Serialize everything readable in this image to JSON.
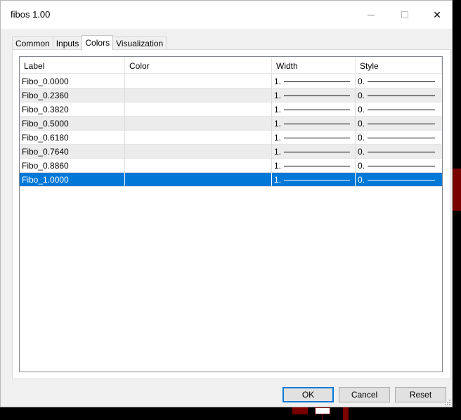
{
  "window": {
    "title": "fibos 1.00"
  },
  "titlebar_buttons": {
    "minimize": "minimize-icon",
    "maximize": "maximize-icon",
    "close": "close-icon",
    "close_glyph": "✕"
  },
  "tabs": [
    {
      "label": "Common",
      "active": false
    },
    {
      "label": "Inputs",
      "active": false
    },
    {
      "label": "Colors",
      "active": true
    },
    {
      "label": "Visualization",
      "active": false
    }
  ],
  "table": {
    "columns": [
      "Label",
      "Color",
      "Width",
      "Style"
    ],
    "rows": [
      {
        "label": "Fibo_0.0000",
        "color": "",
        "width": "1.",
        "style": "0."
      },
      {
        "label": "Fibo_0.2360",
        "color": "",
        "width": "1.",
        "style": "0."
      },
      {
        "label": "Fibo_0.3820",
        "color": "",
        "width": "1.",
        "style": "0."
      },
      {
        "label": "Fibo_0.5000",
        "color": "",
        "width": "1.",
        "style": "0."
      },
      {
        "label": "Fibo_0.6180",
        "color": "",
        "width": "1.",
        "style": "0."
      },
      {
        "label": "Fibo_0.7640",
        "color": "",
        "width": "1.",
        "style": "0."
      },
      {
        "label": "Fibo_0.8860",
        "color": "",
        "width": "1.",
        "style": "0."
      },
      {
        "label": "Fibo_1.0000",
        "color": "",
        "width": "1.",
        "style": "0."
      }
    ],
    "selected_index": 7
  },
  "buttons": {
    "ok": "OK",
    "cancel": "Cancel",
    "reset": "Reset"
  },
  "colors": {
    "selection": "#0078d7",
    "background_dark_red": "#7a0000"
  }
}
